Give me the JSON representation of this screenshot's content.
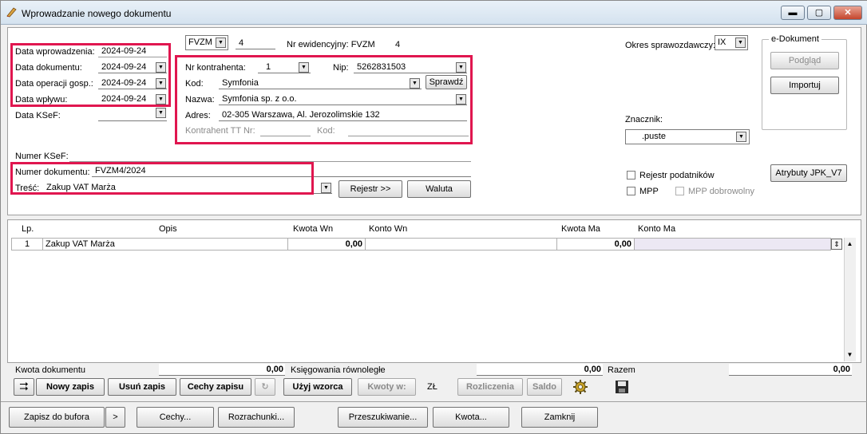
{
  "window": {
    "title": "Wprowadzanie nowego dokumentu",
    "min": "▬",
    "max": "▢",
    "close": "✕"
  },
  "header": {
    "doc_type": "FVZM",
    "doc_number_small": "4",
    "nr_ewidencyjny_label": "Nr ewidencyjny: FVZM",
    "nr_ewidencyjny_value": "4",
    "okres_label": "Okres sprawozdawczy:",
    "okres_value": "IX"
  },
  "dates": {
    "wprowadzenia_label": "Data wprowadzenia:",
    "wprowadzenia_value": "2024-09-24",
    "dokumentu_label": "Data dokumentu:",
    "dokumentu_value": "2024-09-24",
    "operacji_label": "Data operacji gosp.:",
    "operacji_value": "2024-09-24",
    "wplywu_label": "Data wpływu:",
    "wplywu_value": "2024-09-24",
    "ksef_label": "Data KSeF:",
    "ksef_value": ""
  },
  "kontrahent": {
    "nr_label": "Nr kontrahenta:",
    "nr_value": "1",
    "nip_label": "Nip:",
    "nip_value": "5262831503",
    "kod_label": "Kod:",
    "kod_value": "Symfonia",
    "sprawdz": "Sprawdź",
    "nazwa_label": "Nazwa:",
    "nazwa_value": "Symfonia sp. z o.o.",
    "adres_label": "Adres:",
    "adres_value": "02-305 Warszawa, Al. Jerozolimskie 132",
    "tt_label": "Kontrahent TT Nr:",
    "tt_kod_label": "Kod:"
  },
  "edokument": {
    "title": "e-Dokument",
    "podglad": "Podgląd",
    "importuj": "Importuj"
  },
  "znacznik": {
    "label": "Znacznik:",
    "value": ".puste"
  },
  "numer_ksef_label": "Numer KSeF:",
  "numer_dok_label": "Numer dokumentu:",
  "numer_dok_value": "FVZM4/2024",
  "tresc_label": "Treść:",
  "tresc_value": "Zakup VAT Marża",
  "rejestr_btn": "Rejestr >>",
  "waluta_btn": "Waluta",
  "atrybuty_btn": "Atrybuty JPK_V7",
  "checks": {
    "rejestr_podatnikow": "Rejestr podatników",
    "mpp": "MPP",
    "mpp_dobrowolny": "MPP dobrowolny"
  },
  "grid": {
    "headers": {
      "lp": "Lp.",
      "opis": "Opis",
      "kwota_wn": "Kwota  Wn",
      "konto_wn": "Konto  Wn",
      "kwota_ma": "Kwota Ma",
      "konto_ma": "Konto Ma"
    },
    "rows": [
      {
        "lp": "1",
        "opis": "Zakup VAT Marża",
        "kwota_wn": "0,00",
        "konto_wn": "",
        "kwota_ma": "0,00",
        "konto_ma": ""
      }
    ]
  },
  "totals": {
    "kwota_dok_label": "Kwota dokumentu",
    "kwota_dok_value": "0,00",
    "ksiegowania_label": "Księgowania równoległe",
    "ksiegowania_value": "0,00",
    "razem_label": "Razem",
    "razem_value": "0,00"
  },
  "toolbar": {
    "nowy_zapis": "Nowy zapis",
    "usun_zapis": "Usuń zapis",
    "cechy_zapisu": "Cechy zapisu",
    "uzyj_wzorca": "Użyj wzorca",
    "kwoty_w": "Kwoty w:",
    "currency": "ZŁ",
    "rozliczenia": "Rozliczenia",
    "saldo": "Saldo"
  },
  "bottom": {
    "zapisz": "Zapisz do bufora",
    "arrow": ">",
    "cechy": "Cechy...",
    "rozrachunki": "Rozrachunki...",
    "przeszukiwanie": "Przeszukiwanie...",
    "kwota": "Kwota...",
    "zamknij": "Zamknij"
  }
}
